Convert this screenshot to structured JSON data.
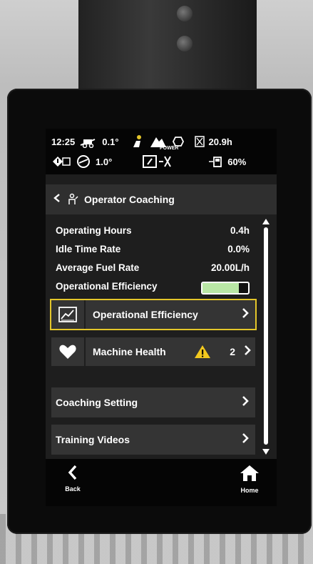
{
  "status": {
    "time": "12:25",
    "tilt_front": "0.1°",
    "tilt_side": "1.0°",
    "hours": "20.9h",
    "fuel_percent": "60%",
    "power_label": "POWER"
  },
  "header": {
    "title": "Operator Coaching"
  },
  "stats": [
    {
      "label": "Operating Hours",
      "value": "0.4h"
    },
    {
      "label": "Idle Time Rate",
      "value": "0.0%"
    },
    {
      "label": "Average Fuel Rate",
      "value": "20.00L/h"
    },
    {
      "label": "Operational Efficiency"
    }
  ],
  "efficiency_level": 0.8,
  "menu": {
    "operational_efficiency": "Operational Efficiency",
    "machine_health": "Machine Health",
    "machine_health_count": "2",
    "coaching_setting": "Coaching Setting",
    "training_videos": "Training Videos"
  },
  "nav": {
    "back": "Back",
    "home": "Home"
  },
  "colors": {
    "accent_yellow": "#e4c62a",
    "efficiency_green": "#b9e7a5",
    "row_bg": "#343434",
    "header_bg": "#2f2f2f",
    "screen_bg": "#1e1e1e"
  },
  "icons": [
    "excavator-tilt-icon",
    "operator-icon",
    "mode-icon",
    "power-icon",
    "hourglass-icon",
    "warning-panel-icon",
    "tilt-side-icon",
    "attachment-icon",
    "fuel-icon",
    "operator-coaching-icon",
    "chart-icon",
    "heart-icon",
    "warning-icon",
    "chevron-right-icon",
    "back-icon",
    "home-icon"
  ]
}
